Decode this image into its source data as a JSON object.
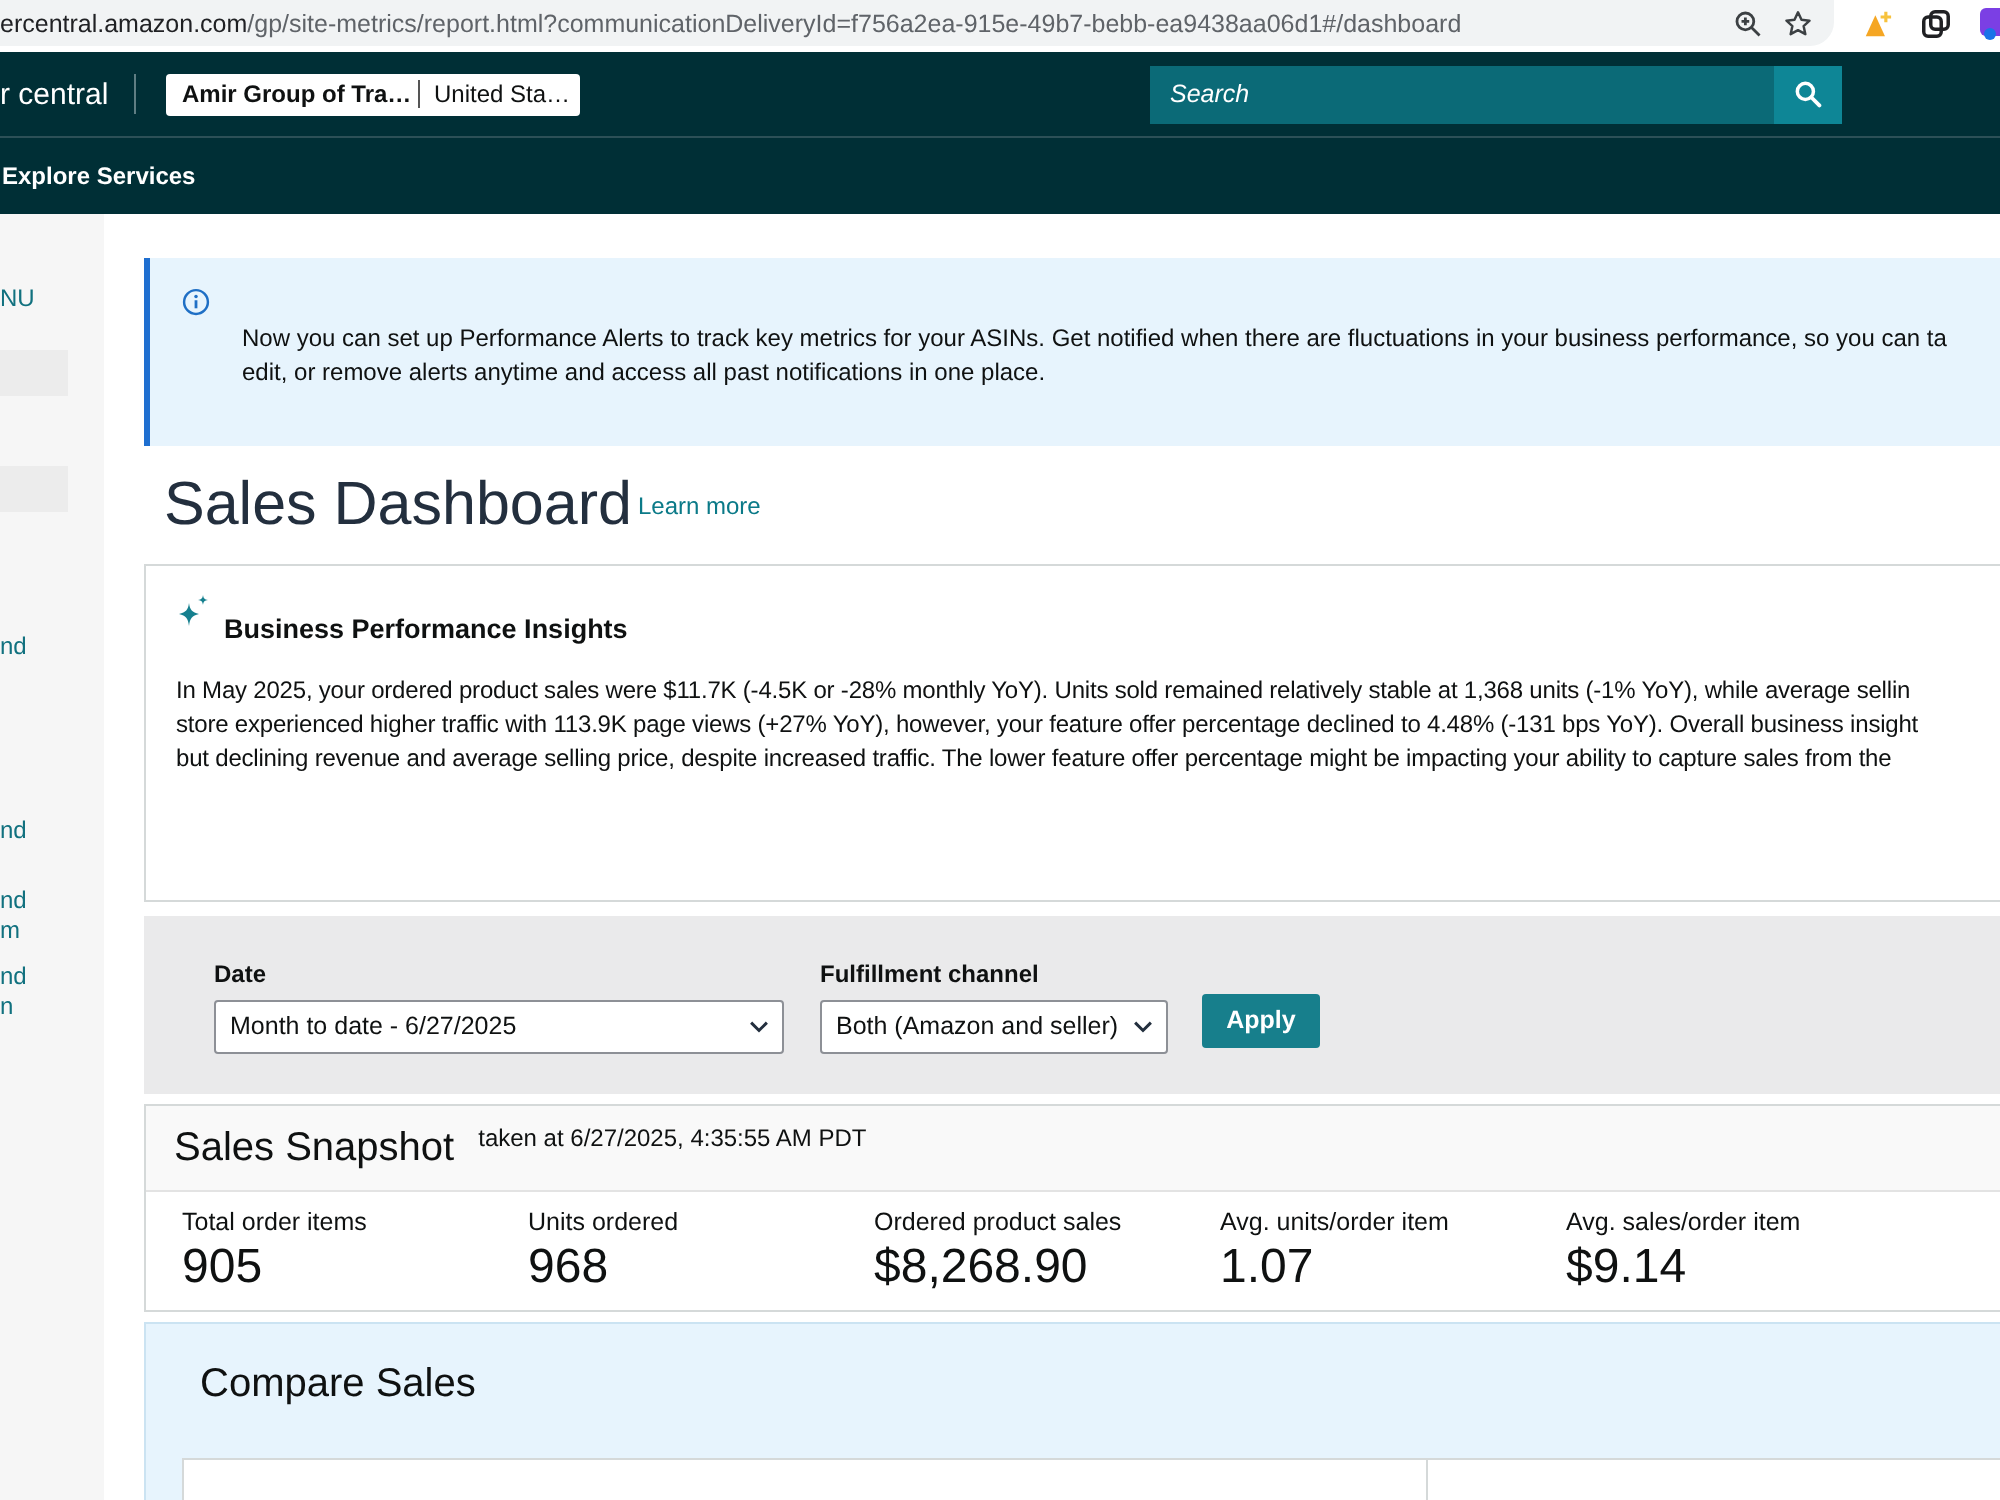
{
  "browser": {
    "url_host": "ercentral.amazon.com",
    "url_path": "/gp/site-metrics/report.html?communicationDeliveryId=f756a2ea-915e-49b7-bebb-ea9438aa06d1#/dashboard"
  },
  "header": {
    "brand": "r central",
    "account": {
      "store": "Amir Group of Tra…",
      "marketplace": "United Sta…"
    },
    "search": {
      "placeholder": "Search"
    }
  },
  "nav": {
    "items": [
      {
        "label": "Explore Services"
      }
    ]
  },
  "sidebar": {
    "items": [
      {
        "kind": "text",
        "lines": [
          "NU"
        ]
      },
      {
        "kind": "block"
      },
      {
        "kind": "block"
      },
      {
        "kind": "text",
        "lines": [
          "nd"
        ]
      },
      {
        "kind": "text",
        "lines": [
          "nd"
        ]
      },
      {
        "kind": "text",
        "lines": [
          "nd",
          "m"
        ]
      },
      {
        "kind": "text",
        "lines": [
          "nd",
          "n"
        ]
      }
    ]
  },
  "info_banner": {
    "lines": [
      "Now you can set up Performance Alerts to track key metrics for your ASINs. Get notified when there are fluctuations in your business performance, so you can ta",
      "edit, or remove alerts anytime and access all past notifications in one place."
    ]
  },
  "page": {
    "title": "Sales Dashboard",
    "learn_more": "Learn more"
  },
  "insights": {
    "title": "Business Performance Insights",
    "lines": [
      "In May 2025, your ordered product sales were $11.7K (-4.5K or -28% monthly YoY). Units sold remained relatively stable at 1,368 units (-1% YoY), while average sellin",
      "store experienced higher traffic with 113.9K page views (+27% YoY), however, your feature offer percentage declined to 4.48% (-131 bps YoY). Overall business insight",
      "but declining revenue and average selling price, despite increased traffic. The lower feature offer percentage might be impacting your ability to capture sales from the"
    ]
  },
  "filters": {
    "fields": [
      {
        "label": "Date",
        "value": "Month to date - 6/27/2025"
      },
      {
        "label": "Fulfillment channel",
        "value": "Both (Amazon and seller)"
      }
    ],
    "apply_button": "Apply"
  },
  "snapshot": {
    "title": "Sales Snapshot",
    "timestamp": "taken at 6/27/2025, 4:35:55 AM PDT",
    "metrics": [
      {
        "label": "Total order items",
        "value": "905"
      },
      {
        "label": "Units ordered",
        "value": "968"
      },
      {
        "label": "Ordered product sales",
        "value": "$8,268.90"
      },
      {
        "label": "Avg. units/order item",
        "value": "1.07"
      },
      {
        "label": "Avg. sales/order item",
        "value": "$9.14"
      }
    ]
  },
  "compare": {
    "title": "Compare Sales"
  }
}
